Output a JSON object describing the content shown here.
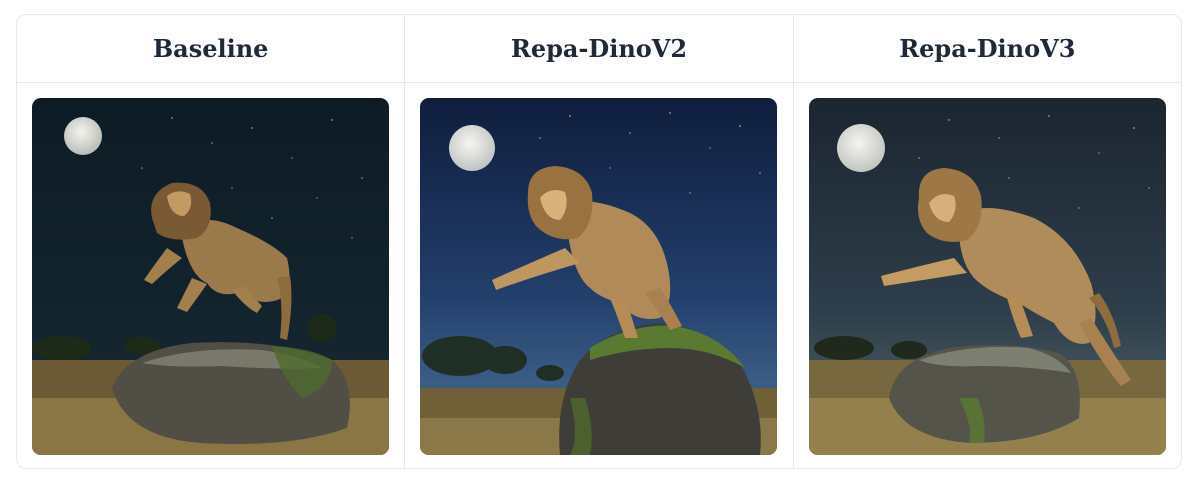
{
  "columns": [
    {
      "label": "Baseline",
      "image": "lion-leaping-over-rock-at-night"
    },
    {
      "label": "Repa-DinoV2",
      "image": "lion-standing-on-rock-at-night"
    },
    {
      "label": "Repa-DinoV3",
      "image": "lion-pouncing-from-rock-at-night"
    }
  ],
  "colors": {
    "border": "#e5e7eb",
    "header_text": "#1f2937"
  }
}
